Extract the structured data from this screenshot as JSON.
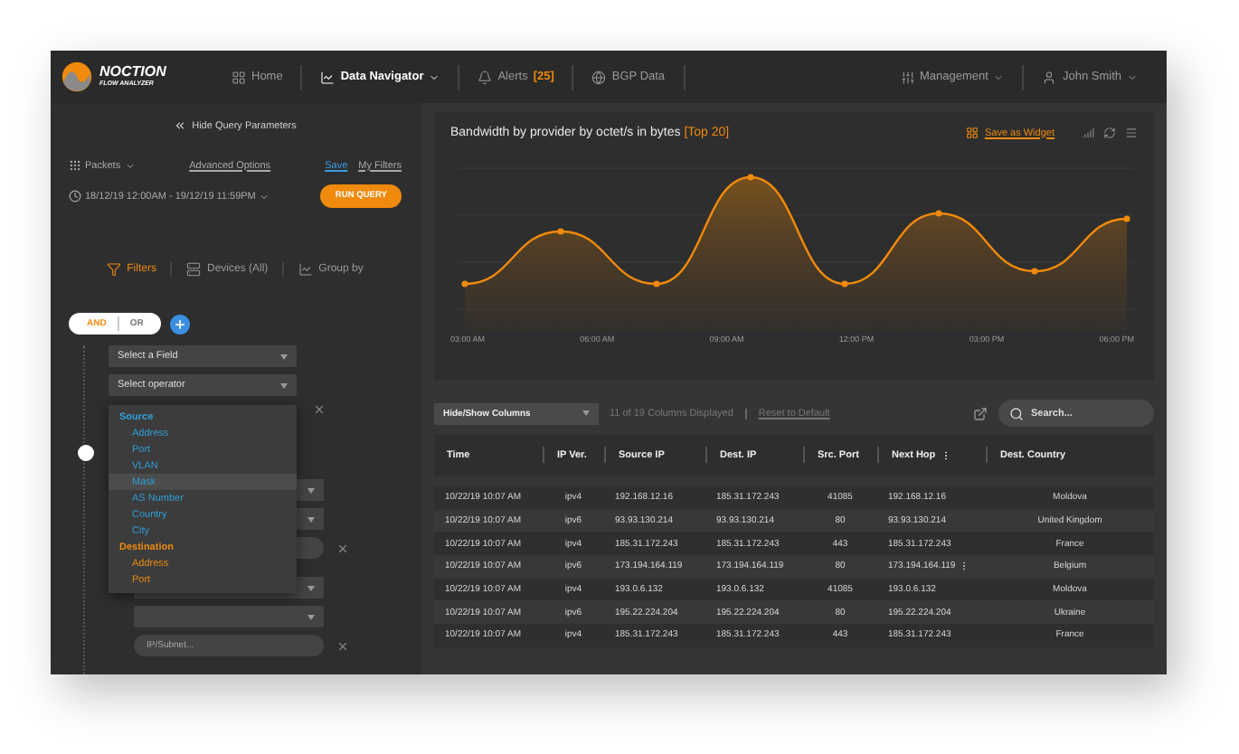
{
  "nav": {
    "logo": {
      "name": "NOCTION",
      "subtitle": "FLOW ANALYZER"
    },
    "items": [
      {
        "label": "Home",
        "selected": false,
        "caret": false
      },
      {
        "label": "Data Navigator",
        "selected": true,
        "caret": true
      },
      {
        "label": "Alerts",
        "badge": "[25]",
        "selected": false,
        "caret": false
      },
      {
        "label": "BGP Data",
        "selected": false,
        "caret": false
      }
    ],
    "right": [
      {
        "label": "Management"
      },
      {
        "label": "John Smith"
      }
    ]
  },
  "query": {
    "hide_link": "Hide Query Parameters",
    "packets": "Packets",
    "advanced": "Advanced Options",
    "save": "Save",
    "my_filters": "My Filters",
    "date_range": "18/12/19 12:00AM - 19/12/19 11:59PM",
    "run": "RUN QUERY",
    "tabs": [
      {
        "label": "Filters",
        "selected": true
      },
      {
        "label": "Devices (All)",
        "selected": false
      },
      {
        "label": "Group by",
        "selected": false
      }
    ],
    "logic": [
      {
        "label": "AND",
        "selected": true
      },
      {
        "label": "OR",
        "selected": false
      }
    ],
    "field_placeholder": "Select a Field",
    "operator_placeholder": "Select operator",
    "value_placeholder": "IP/Subnet...",
    "dropdown": [
      {
        "label": "Source",
        "color": "#2f9fd8",
        "items": [
          {
            "label": "Address",
            "selected": false
          },
          {
            "label": "Port",
            "selected": false
          },
          {
            "label": "VLAN",
            "selected": false
          },
          {
            "label": "Mask",
            "selected": true
          },
          {
            "label": "AS Number",
            "selected": false
          },
          {
            "label": "Country",
            "selected": false
          },
          {
            "label": "City",
            "selected": false
          }
        ]
      },
      {
        "label": "Destination",
        "color": "#ee8a12",
        "items": [
          {
            "label": "Address",
            "selected": false
          },
          {
            "label": "Port",
            "selected": false
          }
        ]
      }
    ]
  },
  "chart": {
    "title": "Bandwidth by provider by octet/s in bytes",
    "badge": "[Top 20]",
    "save_widget": "Save as Widget",
    "x_labels": [
      "03:00 AM",
      "06:00 AM",
      "09:00 AM",
      "12:00 PM",
      "03:00 PM",
      "06:00 PM"
    ]
  },
  "table": {
    "columns_select": "Hide/Show Columns",
    "columns_info": "11 of 19 Columns Displayed",
    "reset": "Reset to Default",
    "search_placeholder": "Search...",
    "columns": [
      {
        "label": "Time",
        "menu": false
      },
      {
        "label": "IP Ver.",
        "menu": false
      },
      {
        "label": "Source IP",
        "menu": false
      },
      {
        "label": "Dest. IP",
        "menu": false
      },
      {
        "label": "Src. Port",
        "menu": false
      },
      {
        "label": "Next Hop",
        "menu": true
      },
      {
        "label": "Dest. Country",
        "menu": false
      }
    ],
    "rows": [
      {
        "menu": false,
        "cells": [
          "10/22/19 10:07 AM",
          "ipv4",
          "192.168.12.16",
          "185.31.172.243",
          "41085",
          "192.168.12.16",
          "Moldova"
        ]
      },
      {
        "menu": false,
        "cells": [
          "10/22/19 10:07 AM",
          "ipv6",
          "93.93.130.214",
          "93.93.130.214",
          "80",
          "93.93.130.214",
          "United Kingdom"
        ]
      },
      {
        "menu": false,
        "cells": [
          "10/22/19 10:07 AM",
          "ipv4",
          "185.31.172.243",
          "185.31.172.243",
          "443",
          "185.31.172.243",
          "France"
        ]
      },
      {
        "menu": true,
        "cells": [
          "10/22/19 10:07 AM",
          "ipv6",
          "173.194.164.119",
          "173.194.164.119",
          "80",
          "173.194.164.119",
          "Belgium"
        ]
      },
      {
        "menu": false,
        "cells": [
          "10/22/19 10:07 AM",
          "ipv4",
          "193.0.6.132",
          "193.0.6.132",
          "41085",
          "193.0.6.132",
          "Moldova"
        ]
      },
      {
        "menu": false,
        "cells": [
          "10/22/19 10:07 AM",
          "ipv6",
          "195.22.224.204",
          "195.22.224.204",
          "80",
          "195.22.224.204",
          "Ukraine"
        ]
      },
      {
        "menu": false,
        "cells": [
          "10/22/19 10:07 AM",
          "ipv4",
          "185.31.172.243",
          "185.31.172.243",
          "443",
          "185.31.172.243",
          "France"
        ]
      }
    ]
  }
}
